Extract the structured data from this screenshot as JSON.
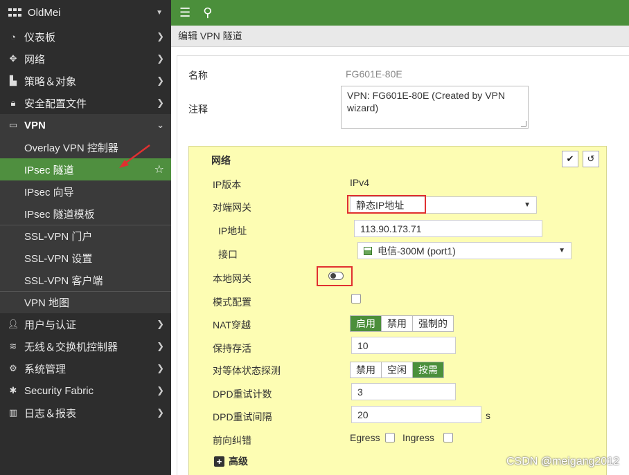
{
  "sidebar": {
    "org": "OldMei",
    "items": [
      {
        "label": "仪表板",
        "icon": "dashboard-icon"
      },
      {
        "label": "网络",
        "icon": "network-icon"
      },
      {
        "label": "策略＆对象",
        "icon": "policy-icon"
      },
      {
        "label": "安全配置文件",
        "icon": "lock-icon"
      }
    ],
    "vpn": {
      "label": "VPN",
      "sub": [
        {
          "label": "Overlay VPN 控制器"
        },
        {
          "label": "IPsec 隧道",
          "active": true
        },
        {
          "label": "IPsec 向导"
        },
        {
          "label": "IPsec 隧道模板"
        },
        {
          "label": "SSL-VPN 门户"
        },
        {
          "label": "SSL-VPN 设置"
        },
        {
          "label": "SSL-VPN 客户端"
        },
        {
          "label": "VPN 地图"
        }
      ]
    },
    "items_after": [
      {
        "label": "用户与认证",
        "icon": "user-icon"
      },
      {
        "label": "无线＆交换机控制器",
        "icon": "wifi-icon"
      },
      {
        "label": "系统管理",
        "icon": "gear-icon"
      },
      {
        "label": "Security Fabric",
        "icon": "fabric-icon"
      },
      {
        "label": "日志＆报表",
        "icon": "chart-icon"
      }
    ]
  },
  "header": {
    "breadcrumb": "编辑 VPN 隧道"
  },
  "form": {
    "name_label": "名称",
    "name_value": "FG601E-80E",
    "comment_label": "注释",
    "comment_value": "VPN: FG601E-80E (Created by VPN wizard)"
  },
  "network": {
    "title": "网络",
    "ip_version_label": "IP版本",
    "ip_version_value": "IPv4",
    "remote_gw_label": "对端网关",
    "remote_gw_value": "静态IP地址",
    "ip_label": "IP地址",
    "ip_value": "113.90.173.71",
    "interface_label": "接口",
    "interface_value": "电信-300M (port1)",
    "local_gw_label": "本地网关",
    "mode_cfg_label": "模式配置",
    "nat_label": "NAT穿越",
    "nat_options": [
      "启用",
      "禁用",
      "强制的"
    ],
    "keepalive_label": "保持存活",
    "keepalive_value": "10",
    "dpd_label": "对等体状态探测",
    "dpd_options": [
      "禁用",
      "空闲",
      "按需"
    ],
    "dpd_retry_count_label": "DPD重试计数",
    "dpd_retry_count_value": "3",
    "dpd_retry_interval_label": "DPD重试间隔",
    "dpd_retry_interval_value": "20",
    "dpd_retry_interval_unit": "s",
    "fec_label": "前向纠错",
    "egress_label": "Egress",
    "ingress_label": "Ingress",
    "advanced_label": "高级"
  },
  "watermark": "CSDN @meigang2012"
}
